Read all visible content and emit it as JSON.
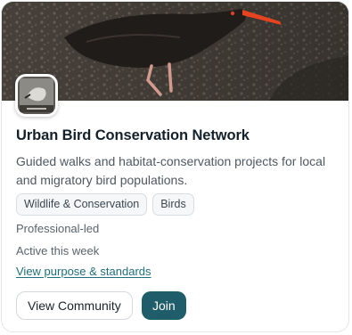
{
  "community": {
    "cover_image_icon": "oystercatcher-photo",
    "avatar_icon": "bird-photo-thumbnail",
    "title": "Urban Bird Conservation Network",
    "description": "Guided walks and habitat-conservation projects for local and migratory bird populations.",
    "tags": [
      "Wildlife & Conservation",
      "Birds"
    ],
    "meta": [
      "Professional-led",
      "Active this week"
    ],
    "link_label": "View purpose & standards"
  },
  "actions": {
    "view_label": "View Community",
    "join_label": "Join"
  },
  "colors": {
    "primary": "#1f5d6a",
    "link": "#1f6f7a",
    "title": "#14212b",
    "beak": "#e8431f"
  }
}
